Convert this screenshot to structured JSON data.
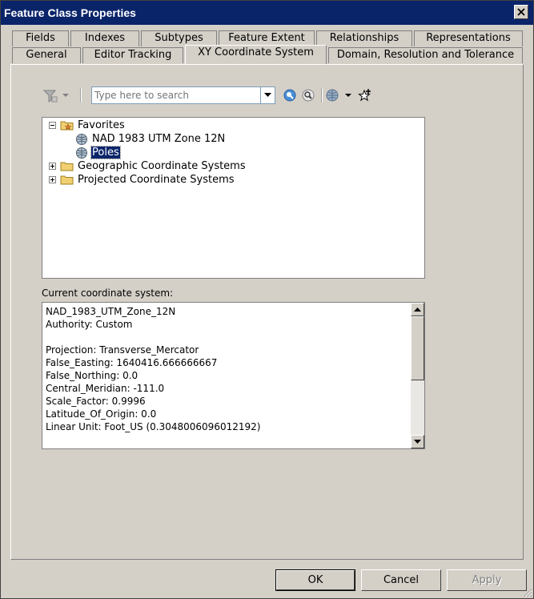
{
  "window": {
    "title": "Feature Class Properties"
  },
  "tabs_back": [
    "Fields",
    "Indexes",
    "Subtypes",
    "Feature Extent",
    "Relationships",
    "Representations"
  ],
  "tabs_front": [
    "General",
    "Editor Tracking",
    "XY Coordinate System",
    "Domain, Resolution and Tolerance"
  ],
  "active_tab": "XY Coordinate System",
  "search": {
    "placeholder": "Type here to search",
    "value": ""
  },
  "tree": {
    "favorites": "Favorites",
    "favorite_items": [
      "NAD 1983 UTM Zone 12N",
      "Poles"
    ],
    "selected": "Poles",
    "geographic": "Geographic Coordinate Systems",
    "projected": "Projected Coordinate Systems"
  },
  "current_label": "Current coordinate system:",
  "details": [
    "NAD_1983_UTM_Zone_12N",
    "Authority: Custom",
    "",
    "Projection: Transverse_Mercator",
    "False_Easting: 1640416.666666667",
    "False_Northing: 0.0",
    "Central_Meridian: -111.0",
    "Scale_Factor: 0.9996",
    "Latitude_Of_Origin: 0.0",
    "Linear Unit: Foot_US (0.3048006096012192)"
  ],
  "buttons": {
    "ok": "OK",
    "cancel": "Cancel",
    "apply": "Apply"
  },
  "icons": [
    "filter-icon",
    "search-go-icon",
    "clear-search-icon",
    "globe-icon",
    "add-favorite-icon",
    "folder-icon",
    "close-icon"
  ],
  "colors": {
    "title_bar": "#0a246a",
    "selection": "#0a246a",
    "dialog": "#d4d0c8"
  }
}
